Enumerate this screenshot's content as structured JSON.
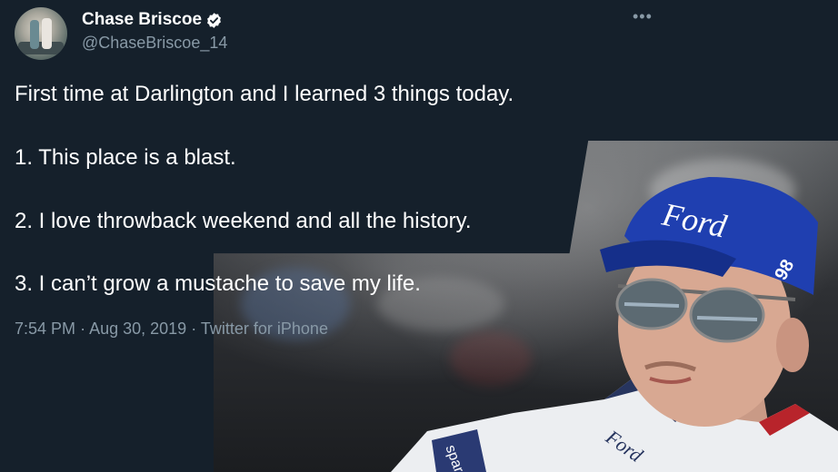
{
  "tweet": {
    "display_name": "Chase Briscoe",
    "handle": "@ChaseBriscoe_14",
    "more_label": "•••",
    "lines": [
      "First time at Darlington and I learned 3 things today.",
      "1. This place is a blast.",
      "2. I love throwback weekend and all the history.",
      "3. I can’t grow a mustache to save my life."
    ],
    "time": "7:54 PM",
    "date": "Aug 30, 2019",
    "source": "Twitter for iPhone",
    "separator": "·"
  },
  "photo": {
    "cap_text": "Ford",
    "cap_number": "98",
    "suit_text_left": "sparco",
    "suit_text_right": "Ford"
  },
  "colors": {
    "background": "#15202b",
    "text_primary": "#ffffff",
    "text_secondary": "#8899a6",
    "cap_blue": "#1f3fb0"
  },
  "icons": [
    "verified-badge-icon",
    "more-options-icon"
  ]
}
